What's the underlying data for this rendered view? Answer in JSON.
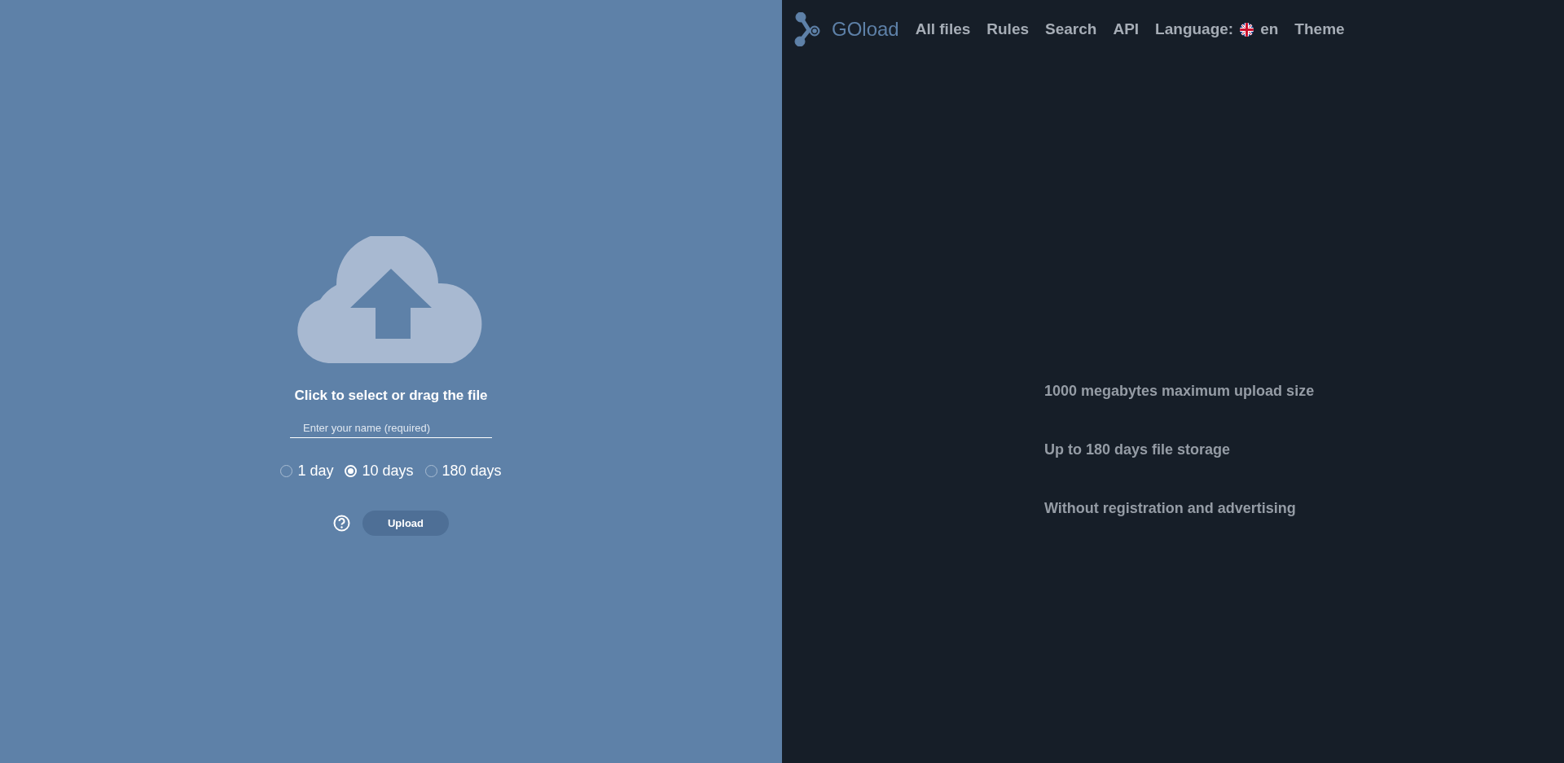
{
  "upload_panel": {
    "prompt": "Click to select or drag the file",
    "name_field": {
      "placeholder": "Enter your name (required)"
    },
    "durations": [
      {
        "label": "1 day",
        "selected": false
      },
      {
        "label": "10 days",
        "selected": true
      },
      {
        "label": "180 days",
        "selected": false
      }
    ],
    "upload_button": "Upload"
  },
  "nav": {
    "brand": "GOload",
    "links": [
      "All files",
      "Rules",
      "Search",
      "API"
    ],
    "language_label": "Language:",
    "language": "en",
    "theme": "Theme"
  },
  "features": [
    "1000 megabytes maximum upload size",
    "Up to 180 days file storage",
    "Without registration and advertising"
  ]
}
